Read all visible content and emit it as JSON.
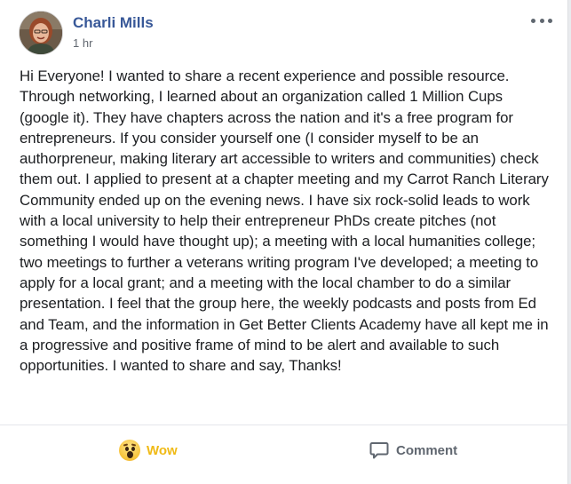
{
  "post": {
    "author": "Charli Mills",
    "time": "1 hr",
    "text": "Hi Everyone! I wanted to share a recent experience and possible resource. Through networking, I learned about an organization called 1 Million Cups (google it). They have chapters across the nation and it's a free program for entrepreneurs. If you consider yourself one (I consider myself to be an authorpreneur, making literary art accessible to writers and communities) check them out. I applied to present at a chapter meeting and my Carrot Ranch Literary Community ended up on the evening news. I have six rock-solid leads to work with a local university to help their entrepreneur PhDs create pitches (not something I would have thought up); a meeting with a local humanities college; two meetings to further a veterans writing program I've developed; a meeting to apply for a local grant; and a meeting with the local chamber to do a similar presentation. I feel that the group here, the weekly podcasts and posts from Ed and Team, and the information in Get Better Clients Academy have all kept me in a progressive and positive frame of mind to be alert and available to such opportunities. I wanted to share and say, Thanks!"
  },
  "actions": {
    "reaction_label": "Wow",
    "reaction_icon": "wow-emoji-icon",
    "comment_label": "Comment",
    "comment_icon": "comment-bubble-icon"
  },
  "colors": {
    "author": "#385898",
    "body_text": "#1c1e21",
    "secondary_text": "#616770",
    "wow_accent": "#f0ba15"
  }
}
